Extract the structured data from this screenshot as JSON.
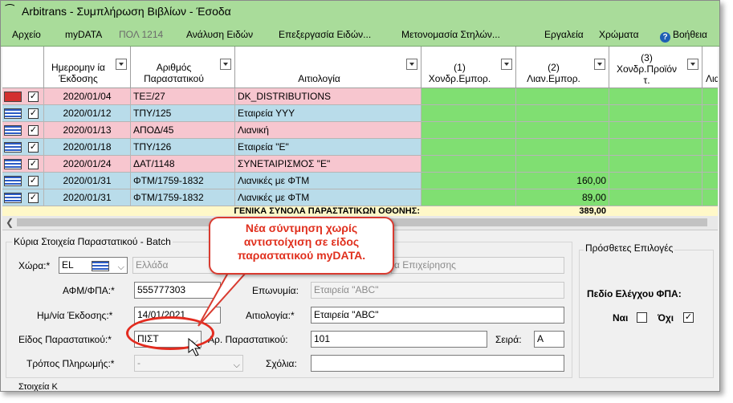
{
  "window": {
    "title": "Arbitrans - Συμπλήρωση Βιβλίων - Έσοδα"
  },
  "menu": [
    {
      "label": "Αρχείο",
      "enabled": true
    },
    {
      "label": "myDATA",
      "enabled": true
    },
    {
      "label": "ΠΟΛ 1214",
      "enabled": false
    },
    {
      "label": "Ανάλυση Ειδών",
      "enabled": true
    },
    {
      "label": "Επεξεργασία Ειδών...",
      "enabled": true
    },
    {
      "label": "Μετονομασία Στηλών...",
      "enabled": true
    },
    {
      "label": "Εργαλεία",
      "enabled": true
    },
    {
      "label": "Χρώματα",
      "enabled": true
    },
    {
      "label": "Βοήθεια",
      "enabled": true
    }
  ],
  "grid": {
    "columns": [
      {
        "line1": "Ημερομην ία",
        "line2": "Έκδοσης"
      },
      {
        "line1": "Αριθμός",
        "line2": "Παραστατικού"
      },
      {
        "line1": "",
        "line2": "Αιτιολογία"
      },
      {
        "line1": "(1)",
        "line2": "Χονδρ.Εμπορ."
      },
      {
        "line1": "(2)",
        "line2": "Λιαν.Εμπορ."
      },
      {
        "line1": "(3)",
        "line2": "Χονδρ.Προϊόν",
        "line3": "τ."
      },
      {
        "line1": "",
        "line2": "Λια"
      }
    ],
    "rows": [
      {
        "date": "2020/01/04",
        "number": "ΤΕΞ/27",
        "reason": "DK_DISTRIBUTIONS",
        "col2": "",
        "color": "#f7c6cf",
        "flag": "red",
        "checked": true
      },
      {
        "date": "2020/01/12",
        "number": "ΤΠΥ/125",
        "reason": "Εταιρεία ΥΥΥ",
        "col2": "",
        "color": "#b9dcea",
        "flag": "gr",
        "checked": true
      },
      {
        "date": "2020/01/13",
        "number": "ΑΠΟΔ/45",
        "reason": "Λιανική",
        "col2": "",
        "color": "#f7c6cf",
        "flag": "gr",
        "checked": true
      },
      {
        "date": "2020/01/18",
        "number": "ΤΠΥ/126",
        "reason": "Εταιρεία \"Ε\"",
        "col2": "",
        "color": "#b9dcea",
        "flag": "gr",
        "checked": true
      },
      {
        "date": "2020/01/24",
        "number": "ΔΑΤ/1148",
        "reason": "ΣΥΝΕΤΑΙΡΙΣΜΟΣ \"Ε\"",
        "col2": "",
        "color": "#f7c6cf",
        "flag": "gr",
        "checked": true
      },
      {
        "date": "2020/01/31",
        "number": "ΦΤΜ/1759-1832",
        "reason": "Λιανικές με ΦΤΜ",
        "col2": "160,00",
        "color": "#b9dcea",
        "flag": "gr",
        "checked": true
      },
      {
        "date": "2020/01/31",
        "number": "ΦΤΜ/1759-1832",
        "reason": "Λιανικές με ΦΤΜ",
        "col2": "89,00",
        "color": "#b9dcea",
        "flag": "gr",
        "checked": true
      }
    ],
    "totals_label": "ΓΕΝΙΚΑ ΣΥΝΟΛΑ ΠΑΡΑΣΤΑΤΙΚΩΝ ΟΘΟΝΗΣ:",
    "totals_col2": "389,00"
  },
  "form": {
    "group_title": "Κύρια Στοιχεία Παραστατικού - Batch",
    "country_label": "Χώρα:*",
    "country_code": "EL",
    "country_name": "Ελλάδα",
    "business_hint": "α Επιχείρησης",
    "vat_label": "ΑΦΜ/ΦΠΑ:*",
    "vat_value": "555777303",
    "name_label": "Επωνυμία:",
    "name_value": "Εταιρεία \"ABC\"",
    "date_label": "Ημ/νία Έκδοσης:*",
    "date_value": "14/01/2021",
    "reason_label": "Αιτιολογία:*",
    "reason_value": "Εταιρεία \"ABC\"",
    "doctype_label": "Είδος Παραστατικού:*",
    "doctype_value": "ΠΙΣΤ",
    "docnum_label": "Αρ. Παραστατικού:",
    "docnum_value": "101",
    "series_label": "Σειρά:",
    "series_value": "A",
    "payment_label": "Τρόπος Πληρωμής:*",
    "payment_value": "-",
    "comments_label": "Σχόλια:",
    "comments_value": "",
    "bottom_label": "Στοιχεία Κ"
  },
  "extra": {
    "title": "Πρόσθετες Επιλογές",
    "vat_check_label": "Πεδίο Ελέγχου ΦΠΑ:",
    "yes_label": "Ναι",
    "no_label": "Όχι",
    "yes_checked": false,
    "no_checked": true
  },
  "callout": {
    "line1": "Νέα σύντμηση χωρίς",
    "line2": "αντιστοίχιση σε είδος",
    "line3": "παραστατικού myDATA."
  },
  "colors": {
    "titlebar": "#a9dc9a",
    "green_cell": "#80df72",
    "pink_row": "#f7c6cf",
    "blue_row": "#b9dcea",
    "accent_red": "#e0301e"
  }
}
